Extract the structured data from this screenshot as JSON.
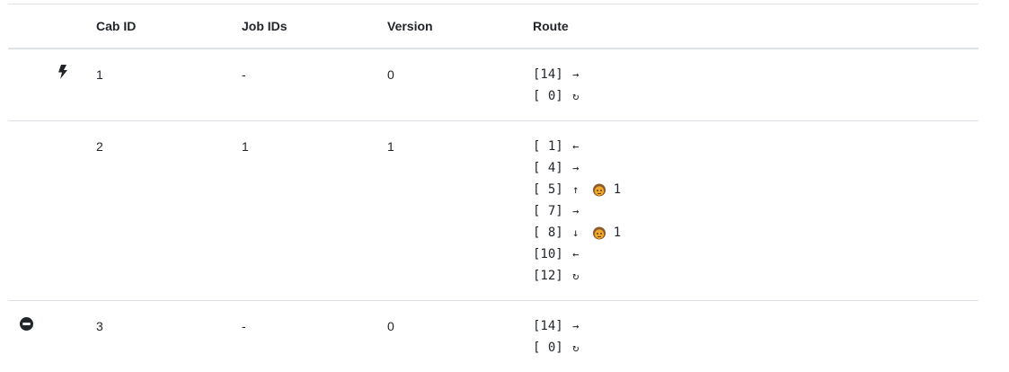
{
  "table": {
    "headers": {
      "icon": "",
      "cab_id": "Cab ID",
      "job_ids": "Job IDs",
      "version": "Version",
      "route": "Route"
    },
    "rows": [
      {
        "status_icon": "lightning-bolt-icon",
        "cab_id": "1",
        "job_ids": "-",
        "version": "0",
        "route": [
          {
            "stop": "[14]",
            "arrow": "→",
            "arrow_icon": "arrow-right-icon",
            "passenger": "",
            "passenger_count": ""
          },
          {
            "stop": "[ 0]",
            "arrow": "↻",
            "arrow_icon": "loop-icon",
            "passenger": "",
            "passenger_count": ""
          }
        ]
      },
      {
        "status_icon": "",
        "cab_id": "2",
        "job_ids": "1",
        "version": "1",
        "route": [
          {
            "stop": "[ 1]",
            "arrow": "←",
            "arrow_icon": "arrow-left-icon",
            "passenger": "",
            "passenger_count": ""
          },
          {
            "stop": "[ 4]",
            "arrow": "→",
            "arrow_icon": "arrow-right-icon",
            "passenger": "",
            "passenger_count": ""
          },
          {
            "stop": "[ 5]",
            "arrow": "↑",
            "arrow_icon": "arrow-up-icon",
            "passenger": "person-icon",
            "passenger_count": "1"
          },
          {
            "stop": "[ 7]",
            "arrow": "→",
            "arrow_icon": "arrow-right-icon",
            "passenger": "",
            "passenger_count": ""
          },
          {
            "stop": "[ 8]",
            "arrow": "↓",
            "arrow_icon": "arrow-down-icon",
            "passenger": "person-icon",
            "passenger_count": "1"
          },
          {
            "stop": "[10]",
            "arrow": "←",
            "arrow_icon": "arrow-left-icon",
            "passenger": "",
            "passenger_count": ""
          },
          {
            "stop": "[12]",
            "arrow": "↻",
            "arrow_icon": "loop-icon",
            "passenger": "",
            "passenger_count": ""
          }
        ]
      },
      {
        "status_icon": "no-entry-icon",
        "cab_id": "3",
        "job_ids": "-",
        "version": "0",
        "route": [
          {
            "stop": "[14]",
            "arrow": "→",
            "arrow_icon": "arrow-right-icon",
            "passenger": "",
            "passenger_count": ""
          },
          {
            "stop": "[ 0]",
            "arrow": "↻",
            "arrow_icon": "loop-icon",
            "passenger": "",
            "passenger_count": ""
          }
        ]
      }
    ]
  },
  "colors": {
    "text": "#212529",
    "border": "#dee2e6",
    "face": "#f0a830"
  }
}
